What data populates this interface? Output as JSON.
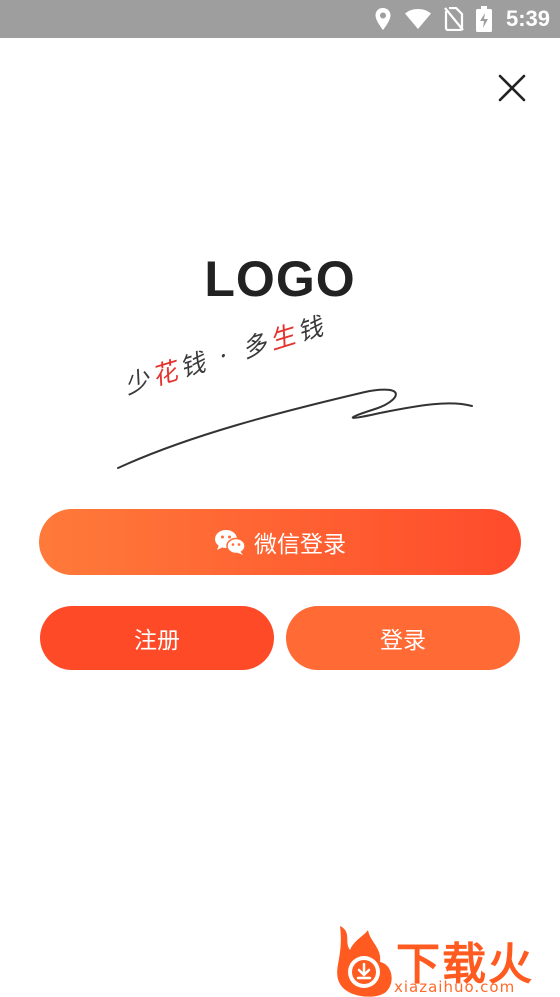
{
  "status_bar": {
    "time": "5:39"
  },
  "app": {
    "logo_text": "LOGO",
    "slogan": {
      "part1": "少",
      "part2": "花",
      "part3": "钱 · 多",
      "part4": "生",
      "part5": "钱"
    }
  },
  "buttons": {
    "wechat_login": "微信登录",
    "register": "注册",
    "login": "登录"
  },
  "watermark": {
    "title": "下载火",
    "url": "xiazaihuo.com"
  },
  "colors": {
    "primary": "#ff4a28",
    "secondary": "#ff6a35",
    "status_bar": "#9e9e9e"
  }
}
